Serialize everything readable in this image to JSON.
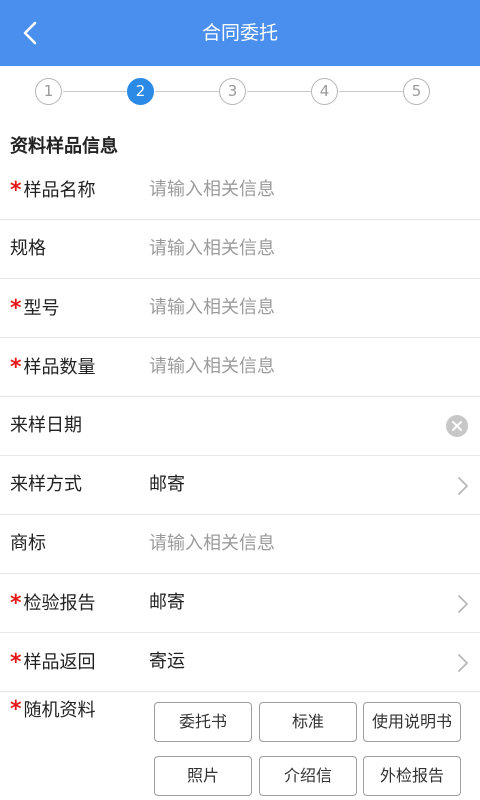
{
  "header": {
    "title": "合同委托"
  },
  "steps": [
    "1",
    "2",
    "3",
    "4",
    "5"
  ],
  "active_step": "2",
  "section_title": "资料样品信息",
  "required_mark": "*",
  "fields": [
    {
      "label": "样品名称",
      "required": true,
      "placeholder": "请输入相关信息",
      "value": "",
      "control": "input"
    },
    {
      "label": "规格",
      "required": false,
      "placeholder": "请输入相关信息",
      "value": "",
      "control": "input"
    },
    {
      "label": "型号",
      "required": true,
      "placeholder": "请输入相关信息",
      "value": "",
      "control": "input"
    },
    {
      "label": "样品数量",
      "required": true,
      "placeholder": "请输入相关信息",
      "value": "",
      "control": "input"
    },
    {
      "label": "来样日期",
      "required": false,
      "placeholder": "",
      "value": "",
      "control": "date-clear"
    },
    {
      "label": "来样方式",
      "required": false,
      "placeholder": "",
      "value": "邮寄",
      "control": "select"
    },
    {
      "label": "商标",
      "required": false,
      "placeholder": "请输入相关信息",
      "value": "",
      "control": "input"
    },
    {
      "label": "检验报告",
      "required": true,
      "placeholder": "",
      "value": "邮寄",
      "control": "select"
    },
    {
      "label": "样品返回",
      "required": true,
      "placeholder": "",
      "value": "寄运",
      "control": "select"
    }
  ],
  "attachments": {
    "label": "随机资料",
    "required": true,
    "options": [
      "委托书",
      "标准",
      "使用说明书",
      "照片",
      "介绍信",
      "外检报告"
    ]
  },
  "colors": {
    "header_bg": "#4a8fee",
    "active_step": "#2b8ae6",
    "required": "#e41a1a"
  }
}
